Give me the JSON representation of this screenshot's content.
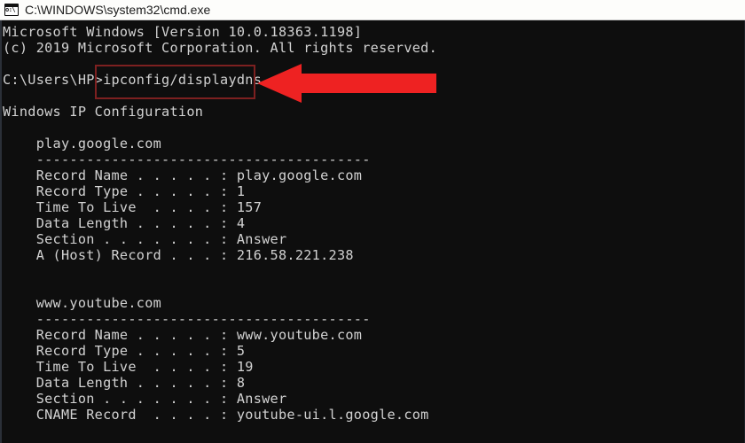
{
  "window": {
    "title": "C:\\WINDOWS\\system32\\cmd.exe",
    "icon": "cmd-console-icon",
    "titlebar_bg": "#fdfdfb",
    "console_bg": "#0e0e0e",
    "console_fg": "#d2d2d2"
  },
  "annotations": {
    "highlight_box": {
      "name": "command-highlight-box",
      "color": "#7d2020",
      "targets": "ipconfig/displaydns"
    },
    "arrow": {
      "name": "red-left-arrow",
      "color": "#ee2222",
      "direction": "left",
      "points_at": "ipconfig/displaydns"
    }
  },
  "terminal": {
    "lines": [
      "Microsoft Windows [Version 10.0.18363.1198]",
      "(c) 2019 Microsoft Corporation. All rights reserved.",
      "",
      "C:\\Users\\HP>ipconfig/displaydns",
      "",
      "Windows IP Configuration",
      "",
      "    play.google.com",
      "    ----------------------------------------",
      "    Record Name . . . . . : play.google.com",
      "    Record Type . . . . . : 1",
      "    Time To Live  . . . . : 157",
      "    Data Length . . . . . : 4",
      "    Section . . . . . . . : Answer",
      "    A (Host) Record . . . : 216.58.221.238",
      "",
      "",
      "    www.youtube.com",
      "    ----------------------------------------",
      "    Record Name . . . . . : www.youtube.com",
      "    Record Type . . . . . : 5",
      "    Time To Live  . . . . : 19",
      "    Data Length . . . . . : 8",
      "    Section . . . . . . . : Answer",
      "    CNAME Record  . . . . : youtube-ui.l.google.com"
    ],
    "command": {
      "prompt": "C:\\Users\\HP>",
      "text": "ipconfig/displaydns"
    },
    "records": [
      {
        "host": "play.google.com",
        "fields": [
          {
            "label": "Record Name",
            "value": "play.google.com"
          },
          {
            "label": "Record Type",
            "value": "1"
          },
          {
            "label": "Time To Live",
            "value": "157"
          },
          {
            "label": "Data Length",
            "value": "4"
          },
          {
            "label": "Section",
            "value": "Answer"
          },
          {
            "label": "A (Host) Record",
            "value": "216.58.221.238"
          }
        ]
      },
      {
        "host": "www.youtube.com",
        "fields": [
          {
            "label": "Record Name",
            "value": "www.youtube.com"
          },
          {
            "label": "Record Type",
            "value": "5"
          },
          {
            "label": "Time To Live",
            "value": "19"
          },
          {
            "label": "Data Length",
            "value": "8"
          },
          {
            "label": "Section",
            "value": "Answer"
          },
          {
            "label": "CNAME Record",
            "value": "youtube-ui.l.google.com"
          }
        ]
      }
    ]
  }
}
